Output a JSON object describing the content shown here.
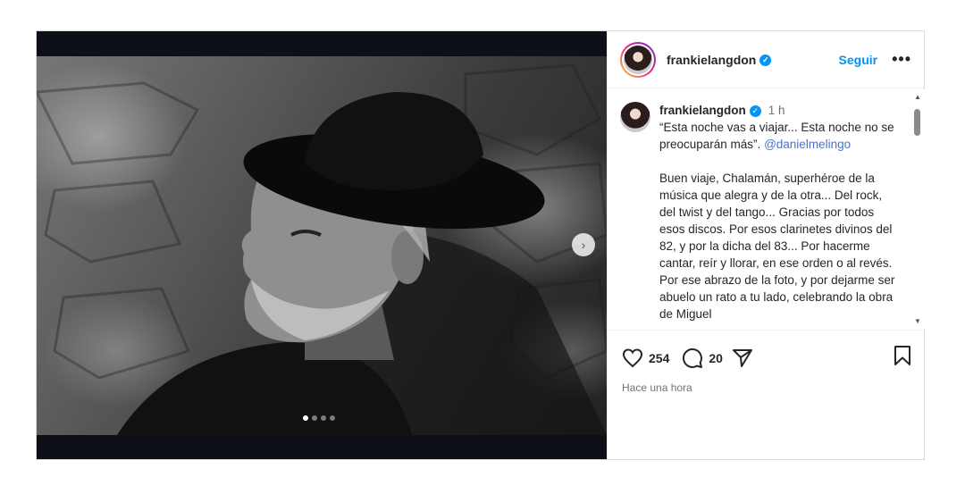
{
  "post": {
    "username": "frankielangdon",
    "follow_label": "Seguir",
    "more_label": "•••",
    "carousel": {
      "slides": 4,
      "active": 1,
      "next_arrow": "›"
    }
  },
  "caption": {
    "username": "frankielangdon",
    "time": "1 h",
    "line1": "“Esta noche vas a viajar... Esta noche no se preocuparán más”.",
    "mention": "@danielmelingo",
    "body": "Buen viaje, Chalamán, superhéroe de la música que alegra y de la otra... Del rock, del twist y del tango... Gracias por todos esos discos. Por esos clarinetes divinos del 82, y por la dicha del 83... Por hacerme cantar, reír y llorar, en ese orden o al revés. Por ese abrazo de la foto, y por dejarme ser abuelo un rato a tu lado, celebrando la obra de Miguel"
  },
  "actions": {
    "likes": "254",
    "comments": "20",
    "icons": [
      "heart-icon",
      "comment-icon",
      "share-icon",
      "bookmark-icon"
    ],
    "timestamp": "Hace una hora"
  },
  "colors": {
    "accent": "#0095f6",
    "mention": "#4a73c9",
    "verified": "#0095f6"
  }
}
